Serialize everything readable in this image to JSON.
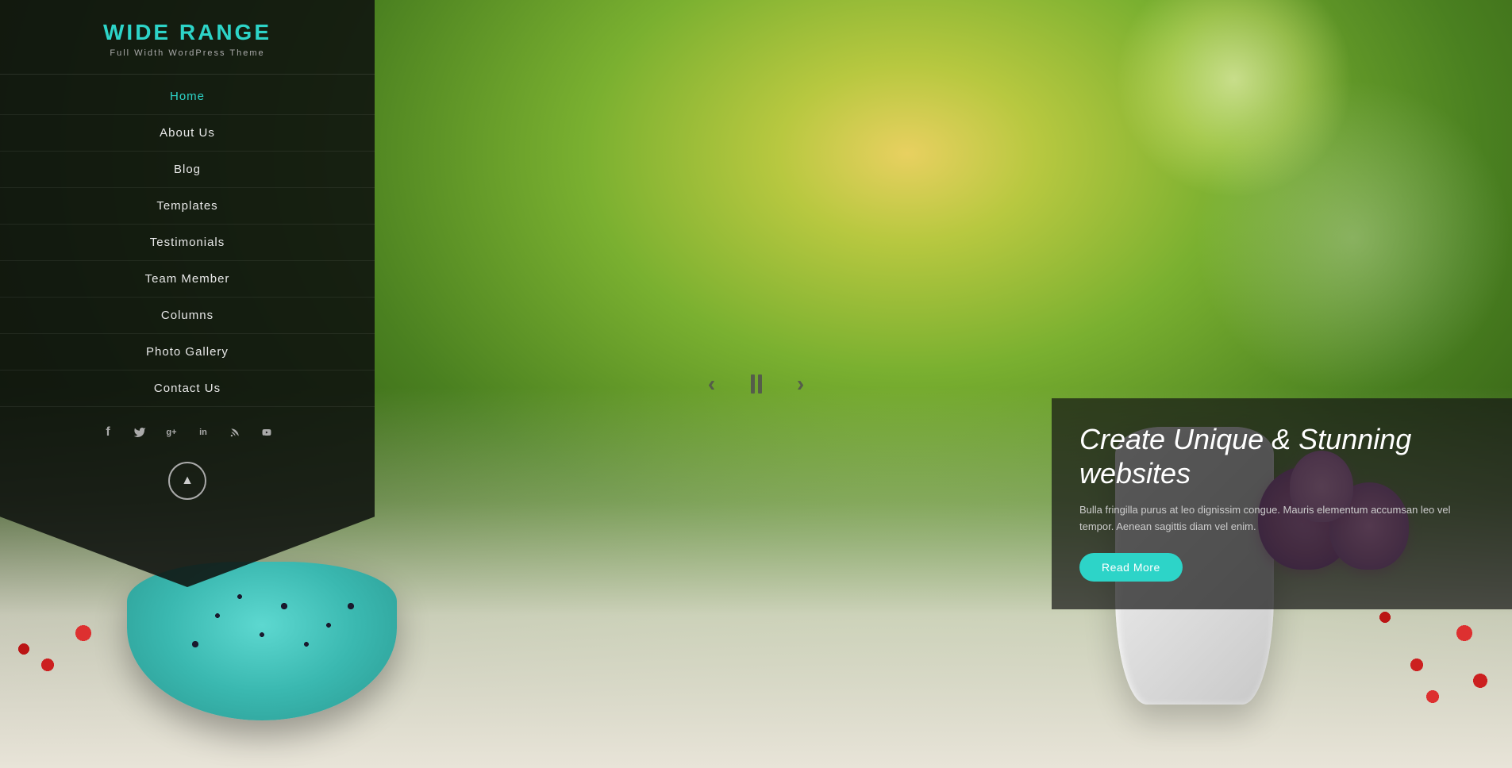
{
  "site": {
    "title": "WIDE RANGE",
    "subtitle": "Full Width WordPress Theme"
  },
  "nav": {
    "items": [
      {
        "label": "Home",
        "active": true
      },
      {
        "label": "About Us",
        "active": false
      },
      {
        "label": "Blog",
        "active": false
      },
      {
        "label": "Templates",
        "active": false
      },
      {
        "label": "Testimonials",
        "active": false
      },
      {
        "label": "Team Member",
        "active": false
      },
      {
        "label": "Columns",
        "active": false
      },
      {
        "label": "Photo Gallery",
        "active": false
      },
      {
        "label": "Contact Us",
        "active": false
      }
    ]
  },
  "social": {
    "icons": [
      {
        "name": "facebook-icon",
        "symbol": "f"
      },
      {
        "name": "twitter-icon",
        "symbol": "t"
      },
      {
        "name": "google-plus-icon",
        "symbol": "g+"
      },
      {
        "name": "linkedin-icon",
        "symbol": "in"
      },
      {
        "name": "rss-icon",
        "symbol": "rss"
      },
      {
        "name": "youtube-icon",
        "symbol": "yt"
      }
    ]
  },
  "slider": {
    "prev_label": "‹",
    "pause_label": "⏸",
    "next_label": "›"
  },
  "overlay": {
    "title": "Create Unique & Stunning websites",
    "description": "Bulla fringilla purus at leo dignissim congue. Mauris elementum accumsan leo vel tempor. Aenean sagittis diam vel enim.",
    "cta_label": "Read More"
  },
  "scroll_top": {
    "icon": "▲"
  },
  "colors": {
    "accent": "#2dd4c8",
    "sidebar_bg": "rgba(15,18,15,0.88)",
    "overlay_bg": "rgba(20,20,20,0.7)"
  }
}
